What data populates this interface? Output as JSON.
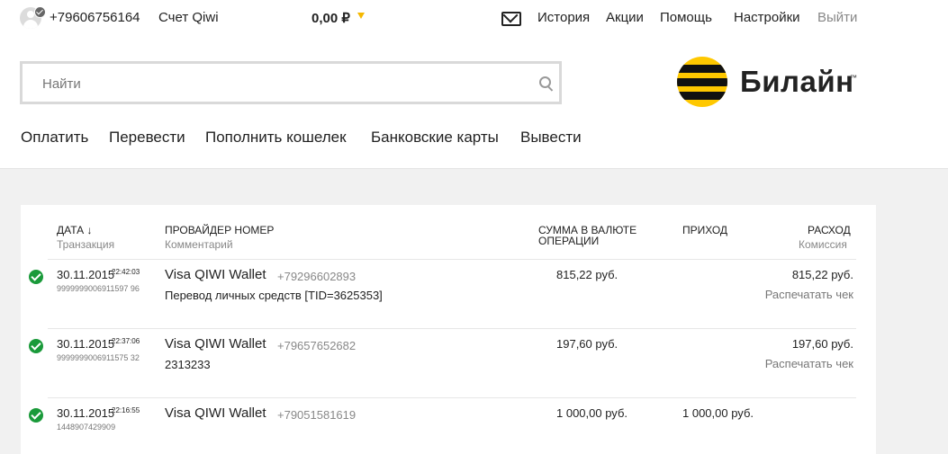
{
  "topbar": {
    "phone": "+79606756164",
    "account_label": "Счет Qiwi",
    "balance": "0,00 ₽",
    "links": {
      "history": "История",
      "promos": "Акции",
      "help": "Помощь",
      "settings": "Настройки",
      "logout": "Выйти"
    }
  },
  "search": {
    "placeholder": "Найти"
  },
  "logo": {
    "text": "Билайн",
    "tm": "™"
  },
  "nav": [
    "Оплатить",
    "Перевести",
    "Пополнить кошелек",
    "Банковские карты",
    "Вывести"
  ],
  "table": {
    "headers": {
      "date": "ДАТА ↓",
      "date_sub": "Транзакция",
      "provider": "ПРОВАЙДЕР НОМЕР",
      "provider_sub": "Комментарий",
      "amount_line1": "СУММА В ВАЛЮТЕ",
      "amount_line2": "ОПЕРАЦИИ",
      "income": "ПРИХОД",
      "expense": "РАСХОД",
      "expense_sub": "Комиссия"
    },
    "rows": [
      {
        "date": "30.11.2015",
        "time": "22:42:03",
        "txn": "9999999006911597 96",
        "provider": "Visa QIWI Wallet",
        "number": "+79296602893",
        "comment": "Перевод личных средств [TID=3625353]",
        "amount": "815,22 руб.",
        "income": "",
        "expense": "815,22 руб.",
        "print": "Распечатать чек"
      },
      {
        "date": "30.11.2015",
        "time": "22:37:06",
        "txn": "9999999006911575 32",
        "provider": "Visa QIWI Wallet",
        "number": "+79657652682",
        "comment": "2313233",
        "amount": "197,60 руб.",
        "income": "",
        "expense": "197,60 руб.",
        "print": "Распечатать чек"
      },
      {
        "date": "30.11.2015",
        "time": "22:16:55",
        "txn": "1448907429909",
        "provider": "Visa QIWI Wallet",
        "number": "+79051581619",
        "comment": "",
        "amount": "1 000,00 руб.",
        "income": "1 000,00 руб.",
        "expense": "",
        "print": ""
      }
    ]
  }
}
